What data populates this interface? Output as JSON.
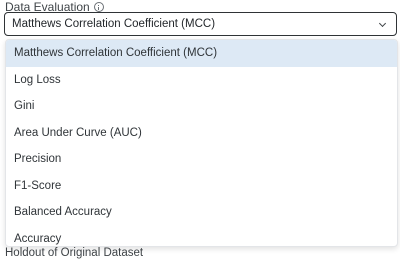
{
  "field": {
    "label": "Data Evaluation",
    "selected_value": "Matthews Correlation Coefficient (MCC)",
    "icons": {
      "info": "info-icon",
      "dropdown": "chevron-down-icon"
    }
  },
  "menu": {
    "items": [
      {
        "label": "Matthews Correlation Coefficient (MCC)",
        "selected": true
      },
      {
        "label": "Log Loss",
        "selected": false
      },
      {
        "label": "Gini",
        "selected": false
      },
      {
        "label": "Area Under Curve (AUC)",
        "selected": false
      },
      {
        "label": "Precision",
        "selected": false
      },
      {
        "label": "F1-Score",
        "selected": false
      },
      {
        "label": "Balanced Accuracy",
        "selected": false
      },
      {
        "label": "Accuracy",
        "selected": false
      }
    ]
  },
  "next_field": {
    "label": "Holdout of Original Dataset"
  },
  "colors": {
    "selected_bg": "#dde9f5",
    "border": "#2f3336"
  }
}
